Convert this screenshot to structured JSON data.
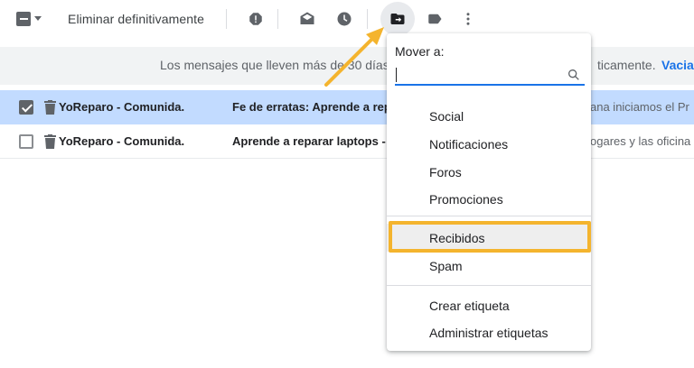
{
  "toolbar": {
    "delete_forever_label": "Eliminar definitivamente",
    "icons": [
      "select-all-icon",
      "report-spam-icon",
      "mark-read-icon",
      "snooze-icon",
      "move-to-icon",
      "label-icon",
      "more-icon"
    ]
  },
  "banner": {
    "message_left": "Los mensajes que lleven más de 30 días",
    "message_right": "ticamente.",
    "empty_link": "Vaciar"
  },
  "emails": [
    {
      "sender": "YoReparo - Comunida.",
      "subject": "Fe de erratas: Aprende a rep",
      "snippet": "ana iniciamos el Pr",
      "selected": true
    },
    {
      "sender": "YoReparo - Comunida.",
      "subject": "Aprende a reparar laptops -",
      "snippet": "ogares y las oficina",
      "selected": false
    }
  ],
  "move_menu": {
    "title": "Mover a:",
    "search_value": "",
    "items": [
      "Social",
      "Notificaciones",
      "Foros",
      "Promociones"
    ],
    "items_main": [
      "Recibidos",
      "Spam"
    ],
    "items_bottom": [
      "Crear etiqueta",
      "Administrar etiquetas"
    ],
    "highlighted_item": "Recibidos"
  },
  "colors": {
    "accent": "#1a73e8",
    "selected_row": "#c2dbff",
    "highlight_annotation": "#f4b42e",
    "banner_bg": "#f1f3f4"
  }
}
